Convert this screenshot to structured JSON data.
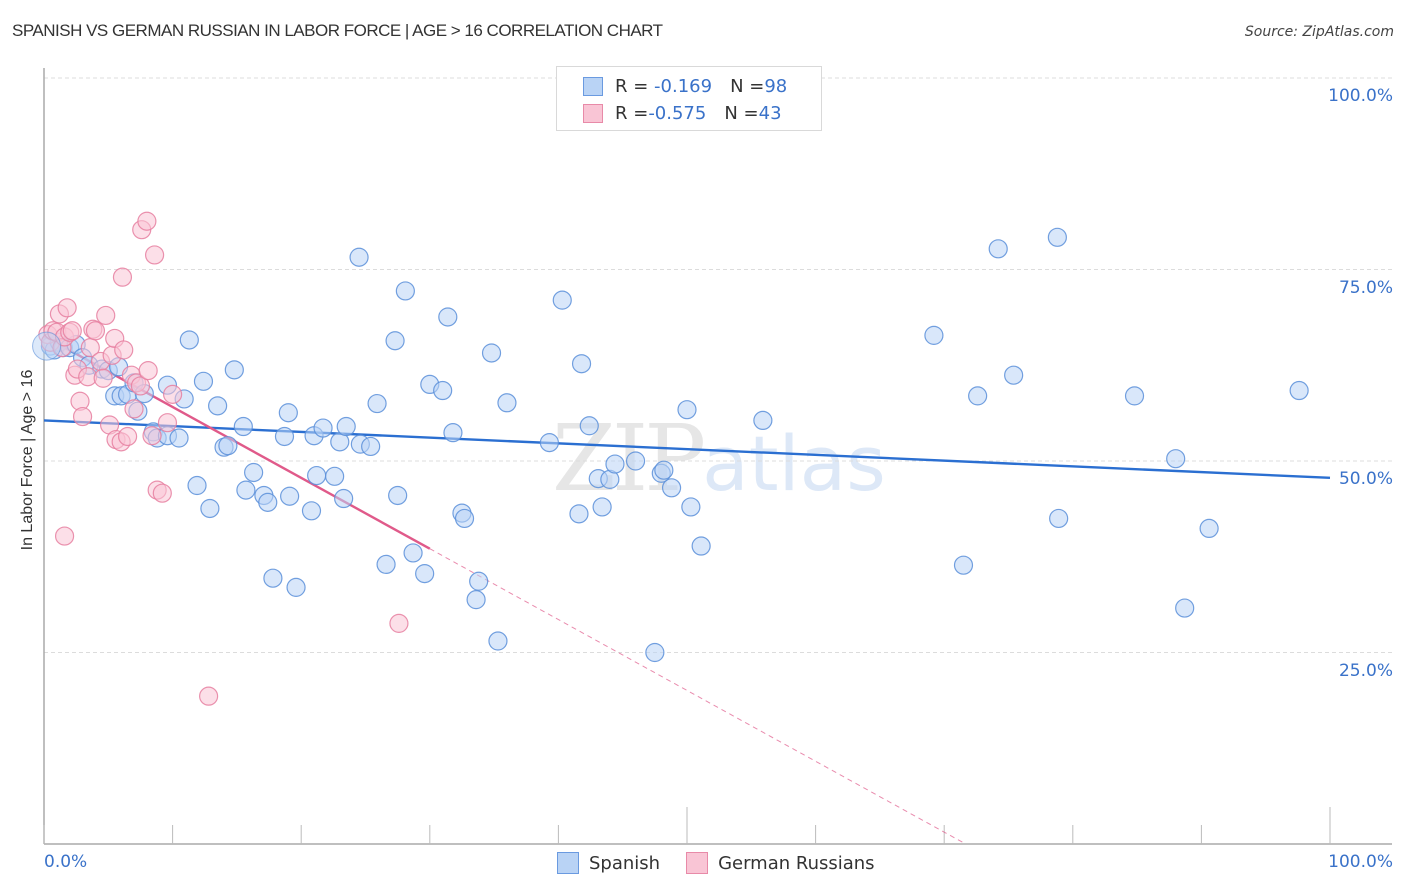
{
  "header": {
    "title": "SPANISH VS GERMAN RUSSIAN IN LABOR FORCE | AGE > 16 CORRELATION CHART",
    "source": "Source: ZipAtlas.com"
  },
  "legend_top": [
    {
      "r_label": "R = ",
      "r_value": "-0.169",
      "n_label": "N = ",
      "n_value": "98"
    },
    {
      "r_label": "R = ",
      "r_value": "-0.575",
      "n_label": "N = ",
      "n_value": "43"
    }
  ],
  "legend_bottom": [
    "Spanish",
    "German Russians"
  ],
  "watermark": {
    "zip": "ZIP",
    "atlas": "atlas"
  },
  "colors": {
    "spanish_fill": "#b9d3f5",
    "spanish_stroke": "#5b8fd9",
    "spanish_line": "#2b6fd1",
    "german_fill": "#f9c5d5",
    "german_stroke": "#e67fa0",
    "german_line": "#e05a8a",
    "tick_label": "#3a72c9"
  },
  "chart_data": {
    "type": "scatter",
    "title": "SPANISH VS GERMAN RUSSIAN IN LABOR FORCE | AGE > 16 CORRELATION CHART",
    "xlabel": "",
    "ylabel": "In Labor Force | Age > 16",
    "xlim": [
      0,
      100
    ],
    "ylim": [
      0,
      100
    ],
    "x_tick_labels": [
      "0.0%",
      "100.0%"
    ],
    "y_tick_labels": [
      "100.0%",
      "75.0%",
      "50.0%",
      "25.0%"
    ],
    "y_ticks": [
      100,
      75,
      50,
      25
    ],
    "grid": true,
    "legend_position": "top-center",
    "series": [
      {
        "name": "Spanish",
        "r": -0.169,
        "n": 98,
        "trend": {
          "x0": 0,
          "y0": 55.3,
          "x1": 100,
          "y1": 47.8,
          "solid_until": 100
        },
        "points": [
          [
            0.5,
            65
          ],
          [
            0.8,
            64.5
          ],
          [
            1.2,
            65.5
          ],
          [
            1.5,
            64.8
          ],
          [
            2,
            64.8
          ],
          [
            2.5,
            65.2
          ],
          [
            3,
            63.5
          ],
          [
            3.5,
            62.5
          ],
          [
            4.5,
            62
          ],
          [
            5,
            61.8
          ],
          [
            5.5,
            58.5
          ],
          [
            6,
            58.5
          ],
          [
            5.8,
            62.3
          ],
          [
            6.5,
            58.7
          ],
          [
            7,
            60.2
          ],
          [
            7.3,
            56.5
          ],
          [
            7.8,
            58.8
          ],
          [
            8.5,
            53.8
          ],
          [
            8.8,
            53
          ],
          [
            9.6,
            53.3
          ],
          [
            10.5,
            53
          ],
          [
            9.6,
            59.9
          ],
          [
            10.9,
            58.1
          ],
          [
            11.3,
            65.8
          ],
          [
            11.9,
            46.8
          ],
          [
            12.4,
            60.4
          ],
          [
            12.9,
            43.8
          ],
          [
            13.5,
            57.2
          ],
          [
            14,
            51.8
          ],
          [
            14.3,
            52
          ],
          [
            14.8,
            61.9
          ],
          [
            15.5,
            54.5
          ],
          [
            15.7,
            46.2
          ],
          [
            16.3,
            48.5
          ],
          [
            17.1,
            45.5
          ],
          [
            17.4,
            44.6
          ],
          [
            17.8,
            34.7
          ],
          [
            18.7,
            53.2
          ],
          [
            19.1,
            45.4
          ],
          [
            19,
            56.3
          ],
          [
            19.6,
            33.5
          ],
          [
            20.8,
            43.5
          ],
          [
            21,
            53.3
          ],
          [
            21.2,
            48.1
          ],
          [
            21.7,
            54.3
          ],
          [
            22.6,
            48
          ],
          [
            23,
            52.5
          ],
          [
            23.3,
            45.1
          ],
          [
            23.5,
            54.5
          ],
          [
            24.5,
            76.6
          ],
          [
            24.6,
            52.2
          ],
          [
            25.4,
            51.9
          ],
          [
            25.9,
            57.5
          ],
          [
            26.6,
            36.5
          ],
          [
            27.3,
            65.7
          ],
          [
            27.5,
            45.5
          ],
          [
            28.1,
            72.2
          ],
          [
            28.7,
            38
          ],
          [
            29.6,
            35.3
          ],
          [
            30,
            60
          ],
          [
            31,
            59.2
          ],
          [
            31.4,
            68.8
          ],
          [
            31.8,
            53.7
          ],
          [
            32.5,
            43.2
          ],
          [
            32.7,
            42.5
          ],
          [
            33.6,
            31.9
          ],
          [
            33.8,
            34.3
          ],
          [
            34.8,
            64.1
          ],
          [
            35.3,
            26.5
          ],
          [
            36,
            57.6
          ],
          [
            39.3,
            52.4
          ],
          [
            40.3,
            71
          ],
          [
            41.6,
            43.1
          ],
          [
            41.8,
            62.7
          ],
          [
            42.4,
            54.6
          ],
          [
            43.1,
            47.7
          ],
          [
            43.4,
            44
          ],
          [
            44,
            47.6
          ],
          [
            44.4,
            49.6
          ],
          [
            46,
            50
          ],
          [
            47.5,
            25
          ],
          [
            48,
            48.4
          ],
          [
            48.2,
            48.8
          ],
          [
            48.8,
            46.5
          ],
          [
            50,
            56.7
          ],
          [
            50.3,
            44
          ],
          [
            51.1,
            38.9
          ],
          [
            55.9,
            55.3
          ],
          [
            69.2,
            66.4
          ],
          [
            71.5,
            36.4
          ],
          [
            72.6,
            58.5
          ],
          [
            74.2,
            77.7
          ],
          [
            75.4,
            61.2
          ],
          [
            78.8,
            79.2
          ],
          [
            78.9,
            42.5
          ],
          [
            84.8,
            58.5
          ],
          [
            88,
            50.3
          ],
          [
            88.7,
            30.8
          ],
          [
            90.6,
            41.2
          ],
          [
            97.6,
            59.2
          ]
        ]
      },
      {
        "name": "German Russians",
        "r": -0.575,
        "n": 43,
        "trend": {
          "x0": 0,
          "y0": 66.3,
          "x1": 100,
          "y1": -26.2,
          "solid_until": 30
        },
        "points": [
          [
            0.3,
            66.5
          ],
          [
            0.5,
            65.5
          ],
          [
            0.7,
            67
          ],
          [
            1,
            66.8
          ],
          [
            1.2,
            69.2
          ],
          [
            1.4,
            64.8
          ],
          [
            1.6,
            66.2
          ],
          [
            1.8,
            70
          ],
          [
            2,
            66.8
          ],
          [
            2.2,
            67
          ],
          [
            2.4,
            61.2
          ],
          [
            2.6,
            62
          ],
          [
            2.8,
            57.8
          ],
          [
            3,
            55.8
          ],
          [
            3.4,
            61
          ],
          [
            3.6,
            64.8
          ],
          [
            3.8,
            67.2
          ],
          [
            4,
            67
          ],
          [
            4.4,
            63
          ],
          [
            4.6,
            60.8
          ],
          [
            4.8,
            69
          ],
          [
            5.1,
            54.7
          ],
          [
            5.3,
            63.8
          ],
          [
            5.5,
            66
          ],
          [
            5.6,
            52.8
          ],
          [
            6,
            52.5
          ],
          [
            6.2,
            64.5
          ],
          [
            6.5,
            53.2
          ],
          [
            6.8,
            61.2
          ],
          [
            7,
            56.8
          ],
          [
            7.2,
            60.2
          ],
          [
            7.5,
            59.8
          ],
          [
            8.1,
            61.8
          ],
          [
            8.4,
            53.3
          ],
          [
            8.8,
            46.2
          ],
          [
            9.2,
            45.8
          ],
          [
            9.6,
            55
          ],
          [
            10,
            58.7
          ],
          [
            12.8,
            19.3
          ],
          [
            27.6,
            28.8
          ],
          [
            6.1,
            74
          ],
          [
            7.6,
            80.2
          ],
          [
            8,
            81.3
          ],
          [
            8.6,
            76.9
          ],
          [
            1.6,
            40.2
          ]
        ]
      }
    ]
  }
}
